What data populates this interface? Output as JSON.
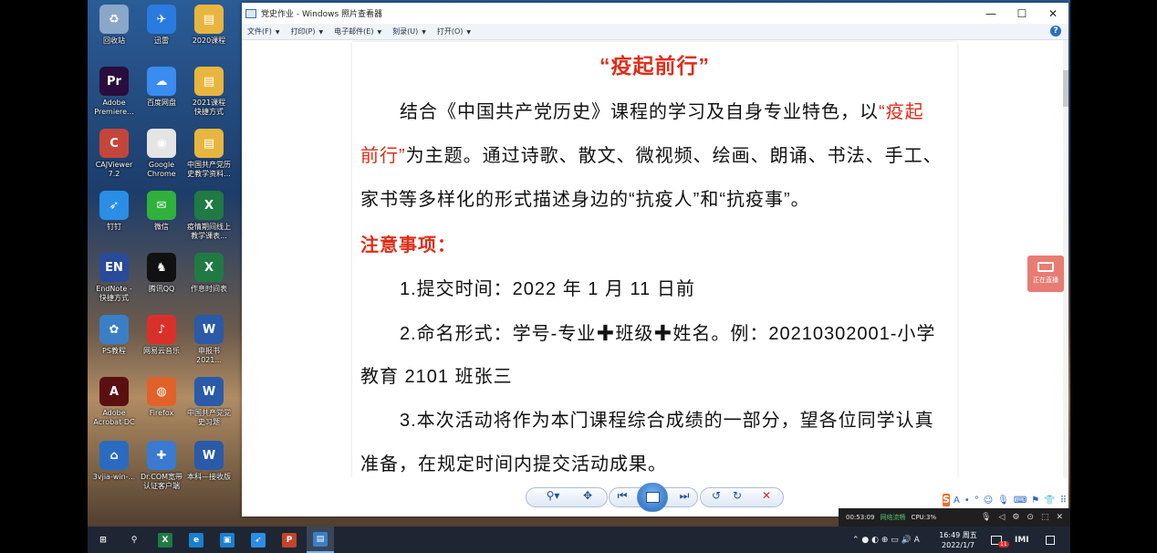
{
  "desktop": {
    "icons": [
      {
        "label": "回收站",
        "color": "#8aa6c8",
        "glyph": "♻"
      },
      {
        "label": "迅雷",
        "color": "#2a7be0",
        "glyph": "✈"
      },
      {
        "label": "2020课程",
        "color": "#e8b63f",
        "glyph": "▤"
      },
      {
        "label": "Adobe\nPremiere...",
        "color": "#2a0d3c",
        "glyph": "Pr"
      },
      {
        "label": "百度网盘",
        "color": "#3a8cf0",
        "glyph": "☁"
      },
      {
        "label": "2021课程\n快捷方式",
        "color": "#e8b63f",
        "glyph": "▤"
      },
      {
        "label": "CAJViewer\n7.2",
        "color": "#c4463a",
        "glyph": "C"
      },
      {
        "label": "Google\nChrome",
        "color": "#e4e4e4",
        "glyph": "◉"
      },
      {
        "label": "中国共产党历\n史教学资料...",
        "color": "#e8b63f",
        "glyph": "▤"
      },
      {
        "label": "钉钉",
        "color": "#2a8de6",
        "glyph": "➶"
      },
      {
        "label": "微信",
        "color": "#2fb13b",
        "glyph": "✉"
      },
      {
        "label": "疫情期间线上\n教学课表...",
        "color": "#1f7a43",
        "glyph": "X"
      },
      {
        "label": "EndNote -\n快捷方式",
        "color": "#2a4a9a",
        "glyph": "EN"
      },
      {
        "label": "腾讯QQ",
        "color": "#111111",
        "glyph": "♞"
      },
      {
        "label": "作息时间表",
        "color": "#1f7a43",
        "glyph": "X"
      },
      {
        "label": "PS教程",
        "color": "#3a7fc6",
        "glyph": "✿"
      },
      {
        "label": "网易云音乐",
        "color": "#d9312a",
        "glyph": "♪"
      },
      {
        "label": "申报书\n2021...",
        "color": "#2a5aa8",
        "glyph": "W"
      },
      {
        "label": "Adobe\nAcrobat DC",
        "color": "#5a1010",
        "glyph": "A"
      },
      {
        "label": "Firefox",
        "color": "#e0622a",
        "glyph": "◍"
      },
      {
        "label": "中国共产党党\n史习题",
        "color": "#2a5aa8",
        "glyph": "W"
      },
      {
        "label": "3vjia-win-...",
        "color": "#2a6bc0",
        "glyph": "⌂"
      },
      {
        "label": "Dr.COM宽带\n认证客户端",
        "color": "#3a7ad0",
        "glyph": "✚"
      },
      {
        "label": "本科—接收版",
        "color": "#2a5aa8",
        "glyph": "W"
      }
    ]
  },
  "viewer": {
    "title": "党史作业 - Windows 照片查看器",
    "menu": [
      {
        "label": "文件(F)"
      },
      {
        "label": "打印(P)"
      },
      {
        "label": "电子邮件(E)"
      },
      {
        "label": "刻录(U)"
      },
      {
        "label": "打开(O)"
      }
    ],
    "help_label": "?",
    "window_buttons": {
      "minimize": "—",
      "maximize": "☐",
      "close": "✕"
    }
  },
  "document": {
    "title": "“疫起前行”",
    "para1_a": "结合《中国共产党历史》课程的学习及自身专业特色，以",
    "para1_b": "“疫起",
    "para2_a": "前行”",
    "para2_b": "为主题。通过诗歌、散文、微视频、绘画、朗诵、书法、手工、",
    "para3": "家书等多样化的形式描述身边的“抗疫人”和“抗疫事”。",
    "notes_heading": "注意事项：",
    "item1": "1.提交时间：2022 年 1 月 11 日前",
    "item2_a": "2.命名形式：学号-专业",
    "item2_b": "班级",
    "item2_c": "姓名。例：20210302001-小学",
    "item2_cont": "教育 2101 班张三",
    "item3": "3.本次活动将作为本门课程综合成绩的一部分，望各位同学认真",
    "item3_cont": "准备，在规定时间内提交活动成果。",
    "plus": "✚"
  },
  "photo_toolbar": {
    "zoom": "⚲▾",
    "fit": "✥",
    "prev": "⏮",
    "next": "⏭",
    "rotate_ccw": "↺",
    "rotate_cw": "↻",
    "delete": "✕"
  },
  "live_widget": {
    "label": "正在直播"
  },
  "ime": {
    "logo": "S",
    "glyphs": [
      "A",
      "•",
      "°",
      "☺",
      "🎙",
      "⌨",
      "⚑",
      "👕",
      "⠿"
    ]
  },
  "meeting_bar": {
    "timer": "00:53:09",
    "network": "网络流畅",
    "cpu": "CPU:3%",
    "icons": [
      "🎙",
      "◁",
      "⚙",
      "⊙",
      "⬚",
      "✕"
    ]
  },
  "taskbar": {
    "apps": [
      {
        "name": "start",
        "glyph": "⊞",
        "color": "#1e2633"
      },
      {
        "name": "search",
        "glyph": "⚲",
        "color": "#1e2633"
      },
      {
        "name": "excel",
        "glyph": "X",
        "color": "#1f7a43"
      },
      {
        "name": "edge",
        "glyph": "e",
        "color": "#1b7fcf"
      },
      {
        "name": "remote",
        "glyph": "▣",
        "color": "#1b7fcf"
      },
      {
        "name": "dingtalk",
        "glyph": "➶",
        "color": "#2a8de6"
      },
      {
        "name": "powerpoint",
        "glyph": "P",
        "color": "#c4432a"
      },
      {
        "name": "photo-viewer",
        "glyph": "▤",
        "color": "#3a7fc6"
      }
    ],
    "tray_symbols": "⌃ ● ◐ ⊕ ▭ 🔊 A",
    "time": "16:49 周五",
    "date": "2022/1/7",
    "notif_badge": "11",
    "tray_extra": "IMI"
  }
}
